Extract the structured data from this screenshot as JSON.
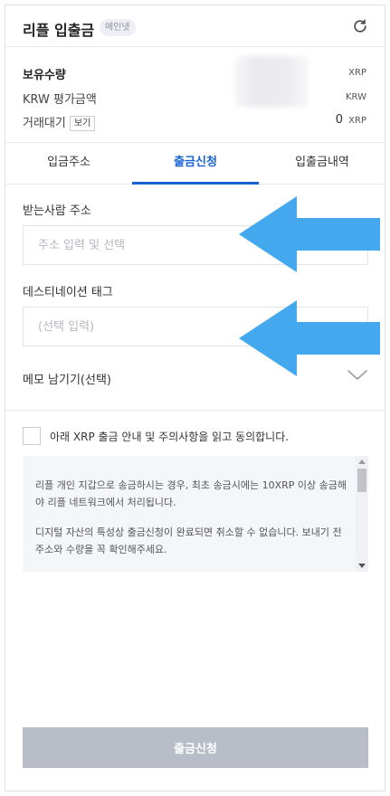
{
  "header": {
    "title": "리플 입출금",
    "network_badge": "메인넷",
    "refresh_icon": "refresh-icon"
  },
  "holdings": {
    "quantity_label": "보유수량",
    "quantity_unit": "XRP",
    "krw_label": "KRW 평가금액",
    "krw_unit": "KRW",
    "pending_label": "거래대기",
    "pending_tag": "보기",
    "pending_value": "0",
    "pending_unit": "XRP"
  },
  "tabs": [
    {
      "label": "입금주소",
      "active": false
    },
    {
      "label": "출금신청",
      "active": true
    },
    {
      "label": "입출금내역",
      "active": false
    }
  ],
  "form": {
    "recipient_label": "받는사람 주소",
    "recipient_placeholder": "주소 입력 및 선택",
    "tag_label": "데스티네이션 태그",
    "tag_placeholder": "(선택 입력)",
    "memo_label": "메모 남기기(선택)"
  },
  "agreement": {
    "text": "아래 XRP 출금 안내 및 주의사항을 읽고 동의합니다."
  },
  "notice": {
    "paragraph1": "리플 개인 지갑으로 송금하시는 경우, 최초 송금시에는 10XRP 이상 송금해야 리플 네트워크에서 처리됩니다.",
    "paragraph2": "디지털 자산의 특성상 출금신청이 완료되면 취소할 수 없습니다. 보내기 전 주소와 수량을 꼭 확인해주세요."
  },
  "submit": {
    "label": "출금신청"
  },
  "colors": {
    "accent": "#1762d3",
    "arrow": "#3aa3ee",
    "button_disabled": "#b9bdc8"
  }
}
